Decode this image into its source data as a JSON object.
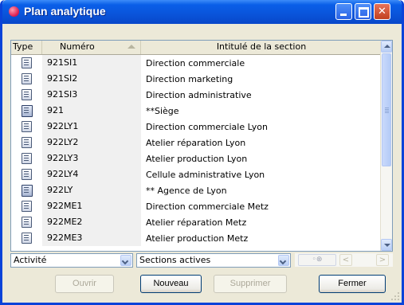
{
  "window": {
    "title": "Plan analytique"
  },
  "columns": {
    "type": "Type",
    "numero": "Numéro",
    "intitule": "Intitulé de la section"
  },
  "rows": [
    {
      "icon": "section-icon",
      "numero": "921SI1",
      "intitule": "Direction commerciale"
    },
    {
      "icon": "section-icon",
      "numero": "921SI2",
      "intitule": "Direction marketing"
    },
    {
      "icon": "section-icon",
      "numero": "921SI3",
      "intitule": "Direction administrative"
    },
    {
      "icon": "group-section-icon",
      "numero": "921",
      "intitule": "**Siège"
    },
    {
      "icon": "section-icon",
      "numero": "922LY1",
      "intitule": "Direction commerciale Lyon"
    },
    {
      "icon": "section-icon",
      "numero": "922LY2",
      "intitule": "Atelier réparation Lyon"
    },
    {
      "icon": "section-icon",
      "numero": "922LY3",
      "intitule": "Atelier production Lyon"
    },
    {
      "icon": "section-icon",
      "numero": "922LY4",
      "intitule": "Cellule administrative Lyon"
    },
    {
      "icon": "group-section-icon",
      "numero": "922LY",
      "intitule": "** Agence de Lyon"
    },
    {
      "icon": "section-icon",
      "numero": "922ME1",
      "intitule": "Direction commerciale Metz"
    },
    {
      "icon": "section-icon",
      "numero": "922ME2",
      "intitule": "Atelier réparation Metz"
    },
    {
      "icon": "section-icon",
      "numero": "922ME3",
      "intitule": "Atelier production Metz"
    }
  ],
  "filters": {
    "axe": "Activité",
    "sections": "Sections actives"
  },
  "buttons": {
    "ouvrir": "Ouvrir",
    "nouveau": "Nouveau",
    "supprimer": "Supprimer",
    "fermer": "Fermer"
  }
}
